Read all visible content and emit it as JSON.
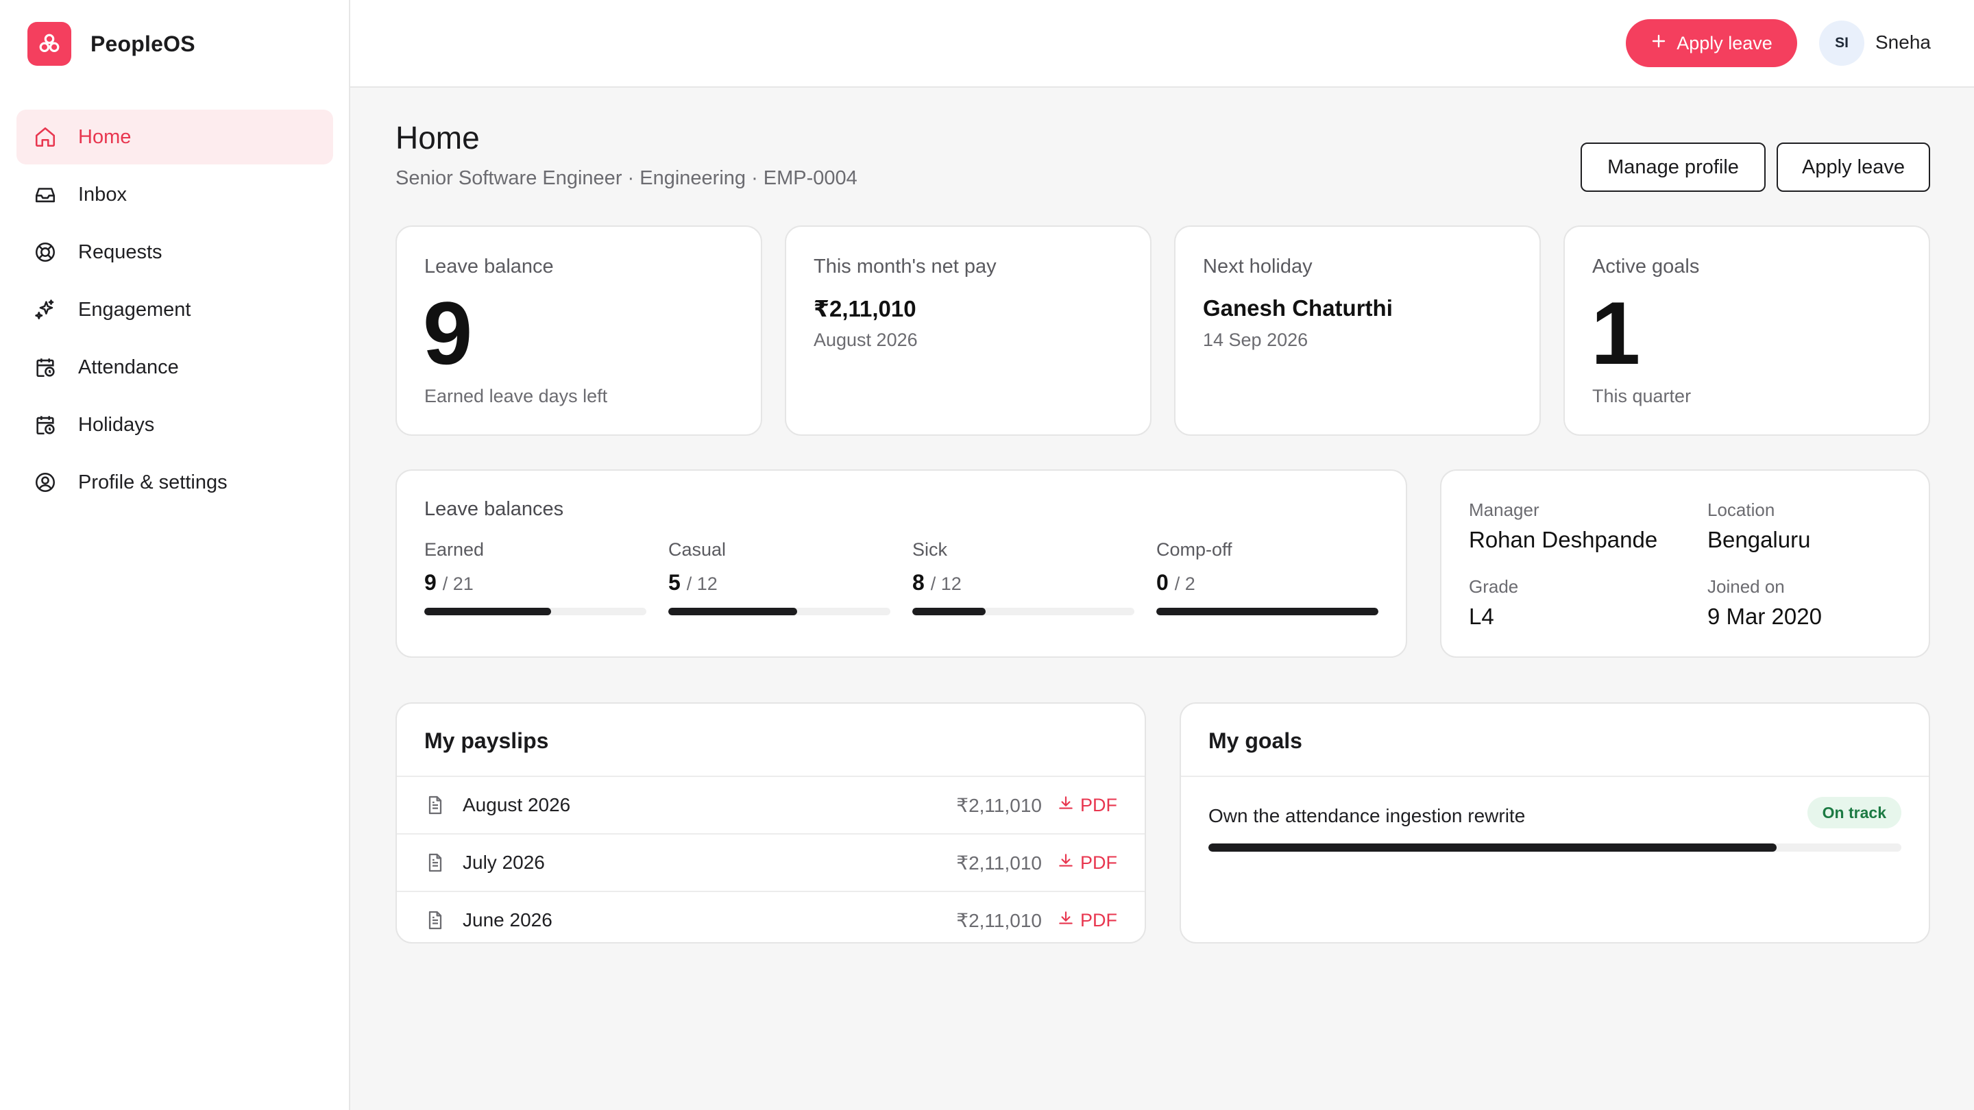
{
  "app": {
    "name": "PeopleOS"
  },
  "sidebar": {
    "items": [
      {
        "label": "Home",
        "icon": "home-icon",
        "active": true
      },
      {
        "label": "Inbox",
        "icon": "inbox-icon"
      },
      {
        "label": "Requests",
        "icon": "lifebuoy-icon"
      },
      {
        "label": "Engagement",
        "icon": "sparkles-icon"
      },
      {
        "label": "Attendance",
        "icon": "calendar-clock-icon"
      },
      {
        "label": "Holidays",
        "icon": "calendar-clock-icon"
      },
      {
        "label": "Profile & settings",
        "icon": "user-circle-icon"
      }
    ]
  },
  "header": {
    "apply_label": "Apply leave",
    "avatar_initials": "SI",
    "user_name": "Sneha"
  },
  "page": {
    "title": "Home",
    "subtitle": "Senior Software Engineer · Engineering · EMP-0004",
    "manage_profile_label": "Manage profile",
    "apply_leave_label": "Apply leave"
  },
  "stats": {
    "leave_balance": {
      "label": "Leave balance",
      "value": "9",
      "foot": "Earned leave days left"
    },
    "net_pay": {
      "label": "This month's net pay",
      "value": "₹2,11,010",
      "sub": "August 2026"
    },
    "next_holiday": {
      "label": "Next holiday",
      "value": "Ganesh Chaturthi",
      "sub": "14 Sep 2026"
    },
    "active_goals": {
      "label": "Active goals",
      "value": "1",
      "foot": "This quarter"
    }
  },
  "leave_balances": {
    "title": "Leave balances",
    "items": [
      {
        "name": "Earned",
        "used": "9",
        "total": "/ 21",
        "fraction": 0.57
      },
      {
        "name": "Casual",
        "used": "5",
        "total": "/ 12",
        "fraction": 0.58
      },
      {
        "name": "Sick",
        "used": "8",
        "total": "/ 12",
        "fraction": 0.33
      },
      {
        "name": "Comp-off",
        "used": "0",
        "total": "/ 2",
        "fraction": 1.0
      }
    ]
  },
  "profile_info": {
    "manager_label": "Manager",
    "manager": "Rohan Deshpande",
    "location_label": "Location",
    "location": "Bengaluru",
    "grade_label": "Grade",
    "grade": "L4",
    "joined_label": "Joined on",
    "joined": "9 Mar 2020"
  },
  "payslips": {
    "title": "My payslips",
    "pdf_label": "PDF",
    "rows": [
      {
        "month": "August 2026",
        "amount": "₹2,11,010"
      },
      {
        "month": "July 2026",
        "amount": "₹2,11,010"
      },
      {
        "month": "June 2026",
        "amount": "₹2,11,010"
      }
    ]
  },
  "goals": {
    "title": "My goals",
    "items": [
      {
        "text": "Own the attendance ingestion rewrite",
        "status": "On track",
        "progress": 0.82
      }
    ]
  },
  "colors": {
    "accent": "#f43f5e",
    "accent_text": "#e8364f",
    "success_bg": "#e7f6ec",
    "success_text": "#1c7a43"
  }
}
